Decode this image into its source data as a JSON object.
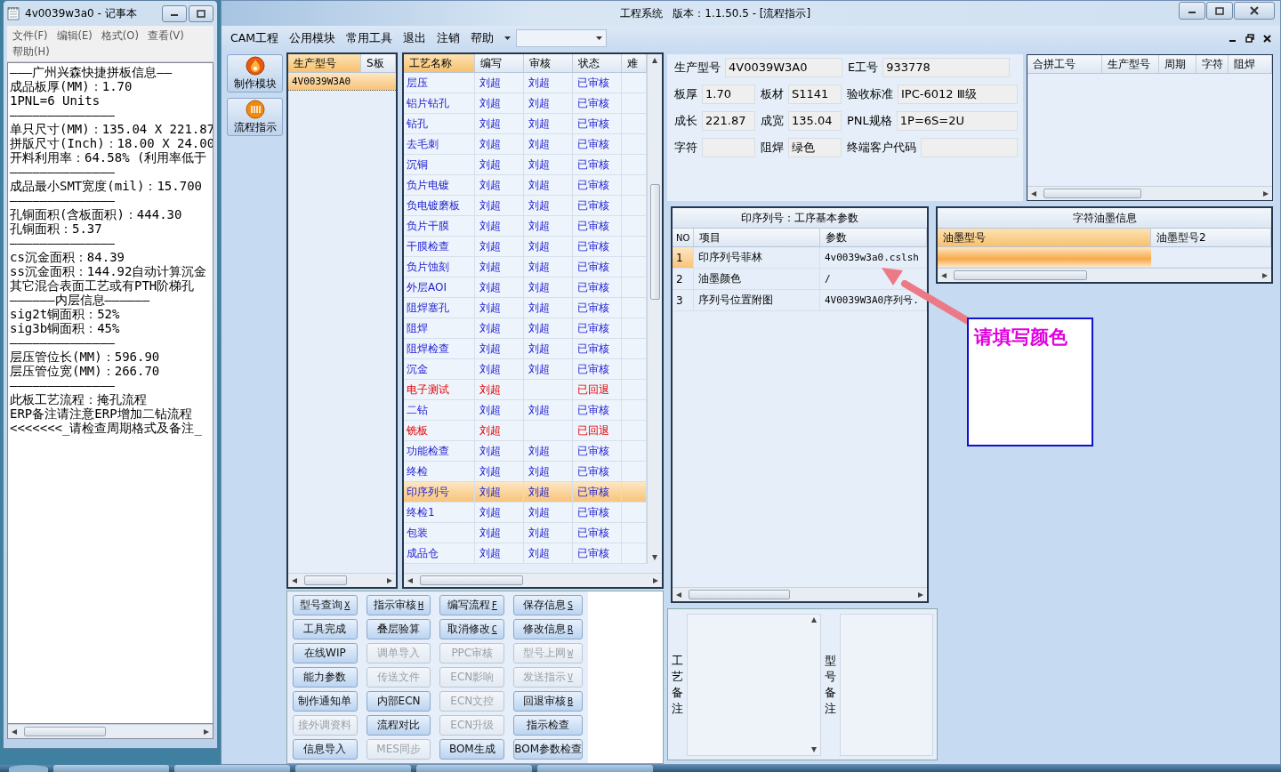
{
  "notepad": {
    "title": "4v0039w3a0 - 记事本",
    "menu": [
      "文件(F)",
      "编辑(E)",
      "格式(O)",
      "查看(V)",
      "帮助(H)"
    ],
    "lines": [
      "———广州兴森快捷拼板信息——",
      "成品板厚(MM)：1.70",
      "1PNL=6 Units",
      "——————————————",
      "单只尺寸(MM)：135.04 X 221.87",
      "拼版尺寸(Inch)：18.00 X 24.00",
      "开料利用率：64.58% (利用率低于",
      "——————————————",
      "成品最小SMT宽度(mil)：15.700",
      "——————————————",
      "孔铜面积(含板面积)：444.30",
      "孔铜面积：5.37",
      "——————————————",
      "cs沉金面积：84.39",
      "ss沉金面积：144.92自动计算沉金",
      "其它混合表面工艺或有PTH阶梯孔",
      "——————内层信息——————",
      "sig2t铜面积：52%",
      "sig3b铜面积：45%",
      "——————————————",
      "层压管位长(MM)：596.90",
      "层压管位宽(MM)：266.70",
      "——————————————",
      "此板工艺流程：掩孔流程",
      "ERP备注请注意ERP增加二钻流程",
      "<<<<<<<_请检查周期格式及备注_"
    ]
  },
  "window": {
    "title": "工程系统   版本：1.1.50.5 - [流程指示]"
  },
  "menu": [
    "CAM工程",
    "公用模块",
    "常用工具",
    "退出",
    "注销",
    "帮助"
  ],
  "sidebar": [
    {
      "label": "制作模块"
    },
    {
      "label": "流程指示"
    }
  ],
  "model_list": {
    "columns": [
      "生产型号",
      "S板"
    ],
    "rows": [
      {
        "model": "4V0039W3A0",
        "selected": true
      }
    ]
  },
  "process_grid": {
    "columns": [
      "工艺名称",
      "编写",
      "审核",
      "状态",
      "难"
    ],
    "rows": [
      {
        "name": "层压",
        "writer": "刘超",
        "reviewer": "刘超",
        "status": "已审核",
        "rejected": false,
        "selected": false
      },
      {
        "name": "铝片钻孔",
        "writer": "刘超",
        "reviewer": "刘超",
        "status": "已审核",
        "rejected": false,
        "selected": false
      },
      {
        "name": "钻孔",
        "writer": "刘超",
        "reviewer": "刘超",
        "status": "已审核",
        "rejected": false,
        "selected": false
      },
      {
        "name": "去毛刺",
        "writer": "刘超",
        "reviewer": "刘超",
        "status": "已审核",
        "rejected": false,
        "selected": false
      },
      {
        "name": "沉铜",
        "writer": "刘超",
        "reviewer": "刘超",
        "status": "已审核",
        "rejected": false,
        "selected": false
      },
      {
        "name": "负片电镀",
        "writer": "刘超",
        "reviewer": "刘超",
        "status": "已审核",
        "rejected": false,
        "selected": false
      },
      {
        "name": "负电镀磨板",
        "writer": "刘超",
        "reviewer": "刘超",
        "status": "已审核",
        "rejected": false,
        "selected": false
      },
      {
        "name": "负片干膜",
        "writer": "刘超",
        "reviewer": "刘超",
        "status": "已审核",
        "rejected": false,
        "selected": false
      },
      {
        "name": "干膜检查",
        "writer": "刘超",
        "reviewer": "刘超",
        "status": "已审核",
        "rejected": false,
        "selected": false
      },
      {
        "name": "负片蚀刻",
        "writer": "刘超",
        "reviewer": "刘超",
        "status": "已审核",
        "rejected": false,
        "selected": false
      },
      {
        "name": "外层AOI",
        "writer": "刘超",
        "reviewer": "刘超",
        "status": "已审核",
        "rejected": false,
        "selected": false
      },
      {
        "name": "阻焊塞孔",
        "writer": "刘超",
        "reviewer": "刘超",
        "status": "已审核",
        "rejected": false,
        "selected": false
      },
      {
        "name": "阻焊",
        "writer": "刘超",
        "reviewer": "刘超",
        "status": "已审核",
        "rejected": false,
        "selected": false
      },
      {
        "name": "阻焊检查",
        "writer": "刘超",
        "reviewer": "刘超",
        "status": "已审核",
        "rejected": false,
        "selected": false
      },
      {
        "name": "沉金",
        "writer": "刘超",
        "reviewer": "刘超",
        "status": "已审核",
        "rejected": false,
        "selected": false
      },
      {
        "name": "电子测试",
        "writer": "刘超",
        "status": "已回退",
        "rejected": true,
        "selected": false
      },
      {
        "name": "二钻",
        "writer": "刘超",
        "reviewer": "刘超",
        "status": "已审核",
        "rejected": false,
        "selected": false
      },
      {
        "name": "铣板",
        "writer": "刘超",
        "status": "已回退",
        "rejected": true,
        "selected": false
      },
      {
        "name": "功能检查",
        "writer": "刘超",
        "reviewer": "刘超",
        "status": "已审核",
        "rejected": false,
        "selected": false
      },
      {
        "name": "终检",
        "writer": "刘超",
        "reviewer": "刘超",
        "status": "已审核",
        "rejected": false,
        "selected": false
      },
      {
        "name": "印序列号",
        "writer": "刘超",
        "reviewer": "刘超",
        "status": "已审核",
        "rejected": false,
        "selected": true
      },
      {
        "name": "终检1",
        "writer": "刘超",
        "reviewer": "刘超",
        "status": "已审核",
        "rejected": false,
        "selected": false
      },
      {
        "name": "包装",
        "writer": "刘超",
        "reviewer": "刘超",
        "status": "已审核",
        "rejected": false,
        "selected": false
      },
      {
        "name": "成品仓",
        "writer": "刘超",
        "reviewer": "刘超",
        "status": "已审核",
        "rejected": false,
        "selected": false
      }
    ]
  },
  "buttons": [
    {
      "label": "型号查询",
      "hotkey": "X",
      "disabled": false
    },
    {
      "label": "指示审核",
      "hotkey": "H",
      "disabled": false
    },
    {
      "label": "编写流程",
      "hotkey": "F",
      "disabled": false
    },
    {
      "label": "保存信息",
      "hotkey": "S",
      "disabled": false
    },
    {
      "label": "工具完成",
      "disabled": false
    },
    {
      "label": "叠层验算",
      "disabled": false
    },
    {
      "label": "取消修改",
      "hotkey": "C",
      "disabled": false
    },
    {
      "label": "修改信息",
      "hotkey": "R",
      "disabled": false
    },
    {
      "label": "在线WIP",
      "disabled": false
    },
    {
      "label": "调单导入",
      "disabled": true
    },
    {
      "label": "PPC审核",
      "disabled": true
    },
    {
      "label": "型号上网",
      "hotkey": "W",
      "disabled": true
    },
    {
      "label": "能力参数",
      "disabled": false
    },
    {
      "label": "传送文件",
      "disabled": true
    },
    {
      "label": "ECN影响",
      "disabled": true
    },
    {
      "label": "发送指示",
      "hotkey": "V",
      "disabled": true
    },
    {
      "label": "制作通知单",
      "disabled": false
    },
    {
      "label": "内部ECN",
      "disabled": false
    },
    {
      "label": "ECN文控",
      "disabled": true
    },
    {
      "label": "回退审核",
      "hotkey": "B",
      "disabled": false
    },
    {
      "label": "接外调资料",
      "disabled": true
    },
    {
      "label": "流程对比",
      "disabled": false
    },
    {
      "label": "ECN升级",
      "disabled": true
    },
    {
      "label": "指示检查",
      "disabled": false
    },
    {
      "label": "信息导入",
      "disabled": false
    },
    {
      "label": "MES同步",
      "disabled": true
    },
    {
      "label": "BOM生成",
      "disabled": false
    },
    {
      "label": "BOM参数检查",
      "disabled": false
    }
  ],
  "form": {
    "rows": [
      {
        "kind": "pair",
        "fields": [
          {
            "label": "生产型号",
            "value": "4V0039W3A0"
          },
          {
            "label": "E工号",
            "value": "933778"
          }
        ]
      },
      {
        "kind": "triple",
        "fields": [
          {
            "label": "板厚",
            "value": "1.70"
          },
          {
            "label": "板材",
            "value": "S1141"
          },
          {
            "label": "验收标准",
            "value": "IPC-6012 Ⅲ级"
          }
        ]
      },
      {
        "kind": "triple",
        "fields": [
          {
            "label": "成长",
            "value": "221.87"
          },
          {
            "label": "成宽",
            "value": "135.04"
          },
          {
            "label": "PNL规格",
            "value": "1P=6S=2U"
          }
        ]
      },
      {
        "kind": "triple",
        "fields": [
          {
            "label": "字符"
          },
          {
            "label": "阻焊",
            "value": "绿色"
          },
          {
            "label": "终端客户代码"
          }
        ]
      }
    ]
  },
  "merge_table": {
    "columns": [
      "合拼工号",
      "生产型号",
      "周期",
      "字符",
      "阻焊"
    ]
  },
  "process_params": {
    "title": "印序列号：工序基本参数",
    "columns": [
      "NO",
      "项目",
      "参数"
    ],
    "rows": [
      {
        "no": "1",
        "item": "印序列号菲林",
        "value": "4v0039w3a0.cslsh",
        "selected": true
      },
      {
        "no": "2",
        "item": "油墨颜色",
        "value": "/",
        "selected": false
      },
      {
        "no": "3",
        "item": "序列号位置附图",
        "value": "4V0039W3A0序列号.",
        "selected": false
      }
    ]
  },
  "ink_info": {
    "title": "字符油墨信息",
    "columns": [
      "油墨型号",
      "油墨型号2"
    ],
    "rows": [
      {
        "selected": true
      }
    ]
  },
  "annotation": {
    "text": "请填写颜色"
  },
  "remarks": [
    {
      "label": "工艺备注"
    },
    {
      "label": "型号备注"
    }
  ]
}
